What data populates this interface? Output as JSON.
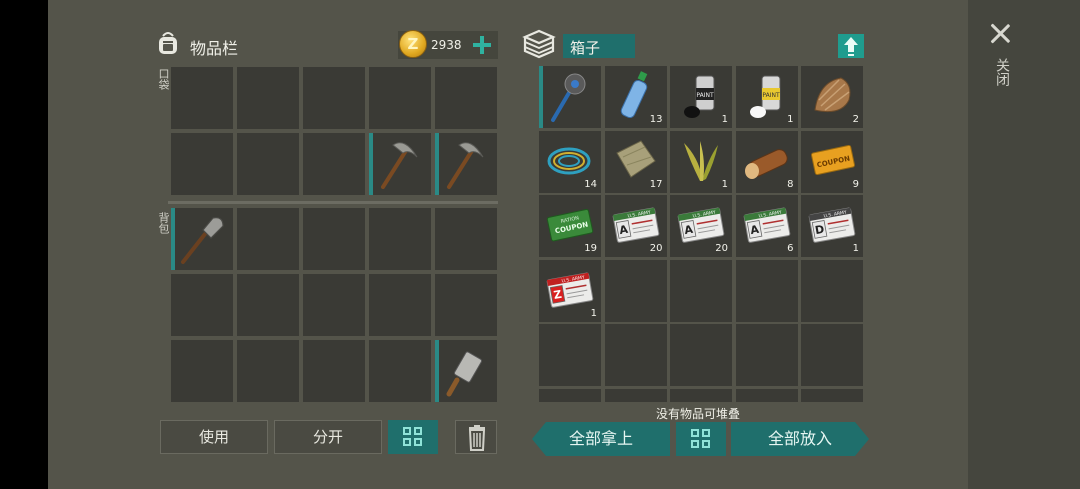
{
  "window": {
    "close_label": "关闭"
  },
  "inventory": {
    "title": "物品栏",
    "coins": "2938",
    "coin_symbol": "Z",
    "pockets_label": "口袋",
    "backpack_label": "背包",
    "pocket_slots": [
      [
        null,
        null,
        null,
        null,
        null
      ],
      [
        null,
        null,
        null,
        {
          "item": "pickaxe-icon"
        },
        {
          "item": "pickaxe-icon"
        }
      ]
    ],
    "backpack_slots": [
      [
        {
          "item": "shovel-icon"
        },
        null,
        null,
        null,
        null
      ],
      [
        null,
        null,
        null,
        null,
        null
      ],
      [
        null,
        null,
        null,
        null,
        {
          "item": "cleaver-icon"
        }
      ]
    ],
    "buttons": {
      "use": "使用",
      "split": "分开"
    }
  },
  "container": {
    "title": "箱子",
    "hint": "没有物品可堆叠",
    "take_all": "全部拿上",
    "put_all": "全部放入",
    "items": [
      {
        "icon": "spiked-club-icon",
        "count": ""
      },
      {
        "icon": "water-bottle-icon",
        "count": "13"
      },
      {
        "icon": "black-paint-can-icon",
        "count": "1"
      },
      {
        "icon": "white-paint-can-icon",
        "count": "1"
      },
      {
        "icon": "fur-icon",
        "count": "2"
      },
      {
        "icon": "wire-coil-icon",
        "count": "14"
      },
      {
        "icon": "cloth-icon",
        "count": "17"
      },
      {
        "icon": "plant-fiber-icon",
        "count": "1"
      },
      {
        "icon": "log-icon",
        "count": "8"
      },
      {
        "icon": "orange-coupon-icon",
        "count": "9"
      },
      {
        "icon": "green-coupon-icon",
        "count": "19"
      },
      {
        "icon": "army-card-a-icon",
        "count": "20"
      },
      {
        "icon": "army-card-a-icon",
        "count": "20"
      },
      {
        "icon": "army-card-a-icon",
        "count": "6"
      },
      {
        "icon": "army-card-d-icon",
        "count": "1"
      },
      {
        "icon": "army-card-z-icon",
        "count": "1"
      }
    ],
    "item_texts": {
      "coupon": "COUPON",
      "coupon_top": "RATION",
      "card_header": "U.S. ARMY",
      "card_a": "A",
      "card_d": "D",
      "card_z": "Z",
      "paint": "PAINT"
    }
  },
  "colors": {
    "teal": "#1f6f6c",
    "teal_bright": "#2fb2a0",
    "panel_bg": "#54544a",
    "slot_bg": "#3a3a35"
  }
}
